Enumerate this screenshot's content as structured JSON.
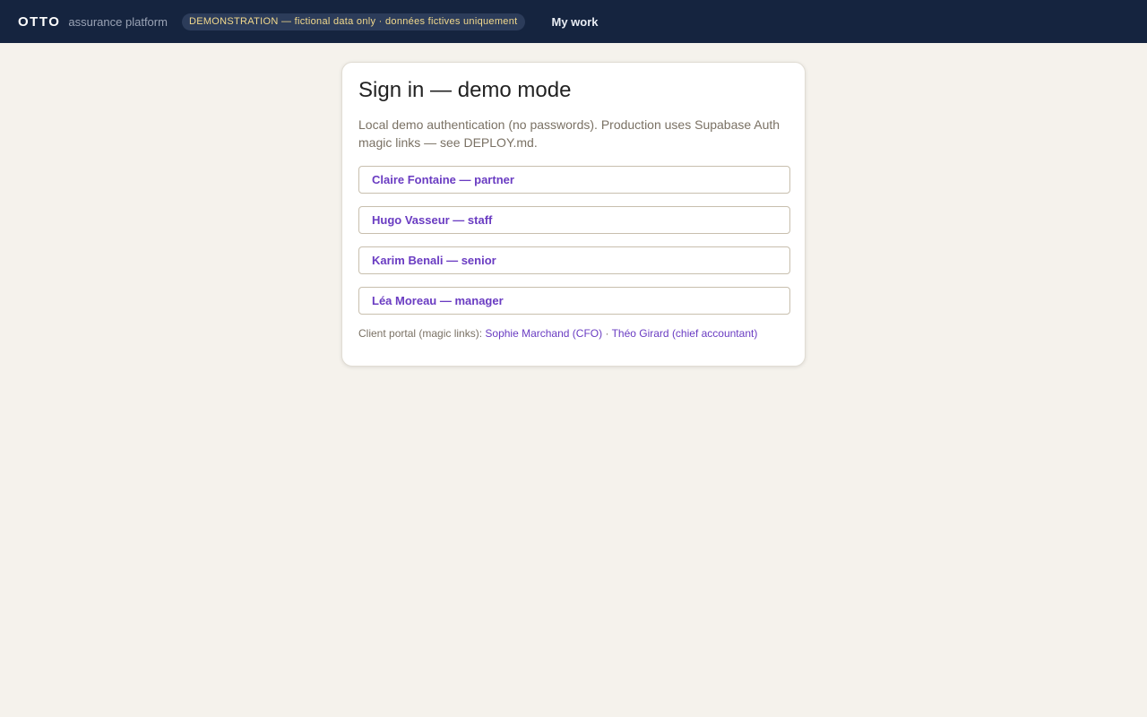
{
  "header": {
    "brand": "OTTO",
    "subtitle": "assurance platform",
    "demo_badge": "DEMONSTRATION — fictional data only · données fictives uniquement",
    "nav_my_work": "My work"
  },
  "signin": {
    "title": "Sign in — demo mode",
    "description": "Local demo authentication (no passwords). Production uses Supabase Auth magic links — see DEPLOY.md.",
    "users": [
      {
        "label": "Claire Fontaine — partner"
      },
      {
        "label": "Hugo Vasseur — staff"
      },
      {
        "label": "Karim Benali — senior"
      },
      {
        "label": "Léa Moreau — manager"
      }
    ],
    "client_portal": {
      "prefix": "Client portal (magic links):",
      "links": [
        {
          "label": "Sophie Marchand (CFO)"
        },
        {
          "label": "Théo Girard (chief accountant)"
        }
      ],
      "separator": "·"
    }
  },
  "colors": {
    "topbar": "#15243f",
    "page_background": "#f5f2ec",
    "accent": "#6a3cc2",
    "badge_text": "#f2d98c"
  }
}
